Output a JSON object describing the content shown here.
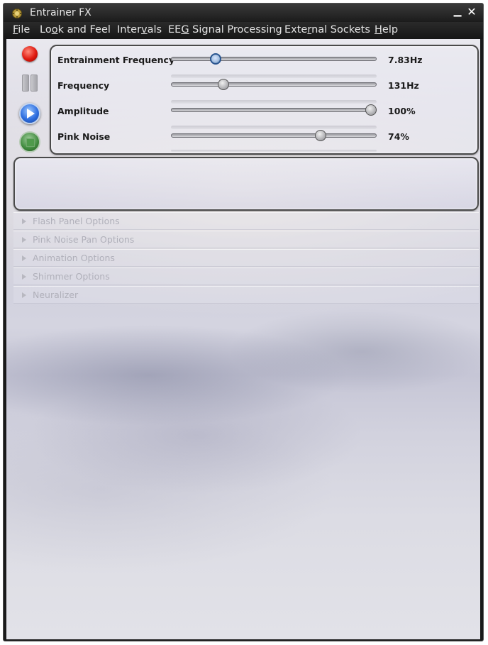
{
  "window": {
    "title": "Entrainer FX",
    "minimize_glyph": "▁",
    "close_glyph": "✕"
  },
  "menu": [
    {
      "pre": "",
      "u": "F",
      "post": "ile"
    },
    {
      "pre": "Lo",
      "u": "o",
      "post": "k and Feel"
    },
    {
      "pre": "Inter",
      "u": "v",
      "post": "als"
    },
    {
      "pre": "EE",
      "u": "G",
      "post": " Signal Processing"
    },
    {
      "pre": "Exte",
      "u": "r",
      "post": "nal Sockets"
    },
    {
      "pre": "",
      "u": "H",
      "post": "elp"
    }
  ],
  "controls": {
    "record": "record-icon",
    "pause": "pause-icon",
    "play": "play-icon",
    "stop": "stop-icon"
  },
  "sliders": [
    {
      "label": "Entrainment Frequency",
      "value": "7.83Hz",
      "position": 0.2,
      "style": "blue"
    },
    {
      "label": "Frequency",
      "value": "131Hz",
      "position": 0.24,
      "style": "gray"
    },
    {
      "label": "Amplitude",
      "value": "100%",
      "position": 1.0,
      "style": "gray"
    },
    {
      "label": "Pink Noise",
      "value": "74%",
      "position": 0.74,
      "style": "gray"
    }
  ],
  "sections": [
    "Flash Panel Options",
    "Pink Noise Pan Options",
    "Animation Options",
    "Shimmer Options",
    "Neuralizer"
  ]
}
